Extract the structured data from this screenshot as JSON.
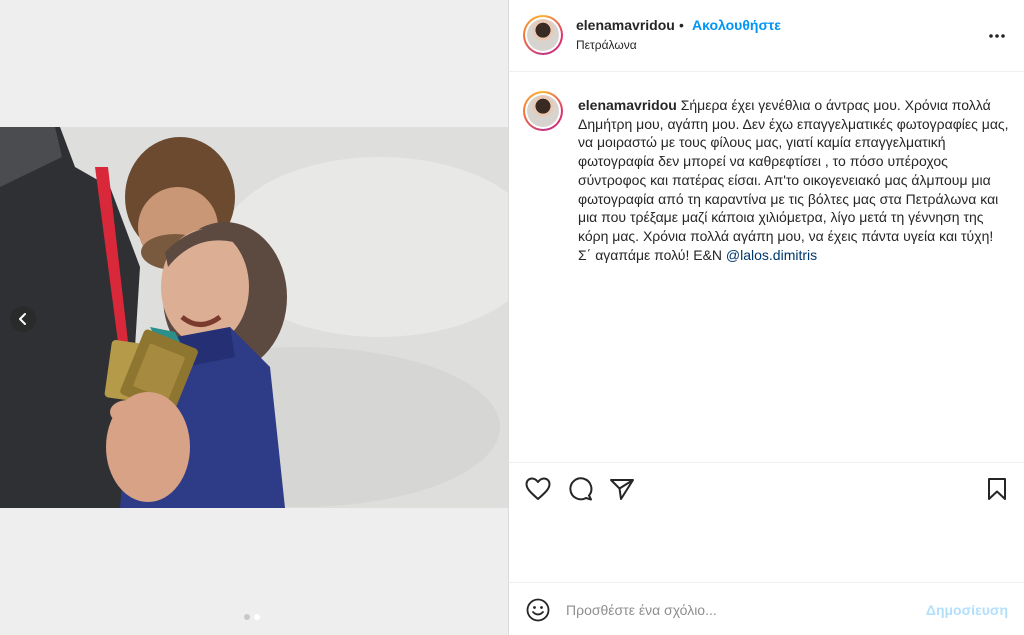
{
  "post": {
    "username": "elenamavridou",
    "bullet": "•",
    "follow_label": "Ακολουθήστε",
    "location": "Πετράλωνα"
  },
  "caption": {
    "username": "elenamavridou",
    "text": "Σήμερα έχει γενέθλια ο άντρας μου. Χρόνια πολλά Δημήτρη μου, αγάπη μου. Δεν έχω επαγγελματικές φωτογραφίες μας, να μοιραστώ με τους φίλους μας, γιατί καμία επαγγελματική φωτογραφία δεν μπορεί να καθρεφτίσει , το πόσο υπέροχος σύντροφος και πατέρας είσαι. Απ'το οικογενειακό μας άλμπουμ μια φωτογραφία από τη καραντίνα με τις βόλτες μας στα Πετράλωνα και μια που τρέξαμε μαζί κάποια χιλιόμετρα, λίγο μετά τη γέννηση της κόρη μας. Χρόνια πολλά αγάπη μου, να έχεις πάντα υγεία και τύχη! Σ΄ αγαπάμε πολύ! E&N",
    "mention": "@lalos.dimitris"
  },
  "media": {
    "carousel_total": 2,
    "carousel_current": 2
  },
  "icons": {
    "prev": "chevron-left-icon",
    "more": "more-options-icon",
    "like": "heart-icon",
    "comment": "comment-icon",
    "share": "paper-plane-icon",
    "save": "bookmark-icon",
    "emoji": "emoji-icon"
  },
  "comment_box": {
    "placeholder": "Προσθέστε ένα σχόλιο...",
    "post_label": "Δημοσίευση"
  },
  "colors": {
    "accent": "#0095f6",
    "mention": "#00376b",
    "post_disabled": "#b2dffc"
  }
}
